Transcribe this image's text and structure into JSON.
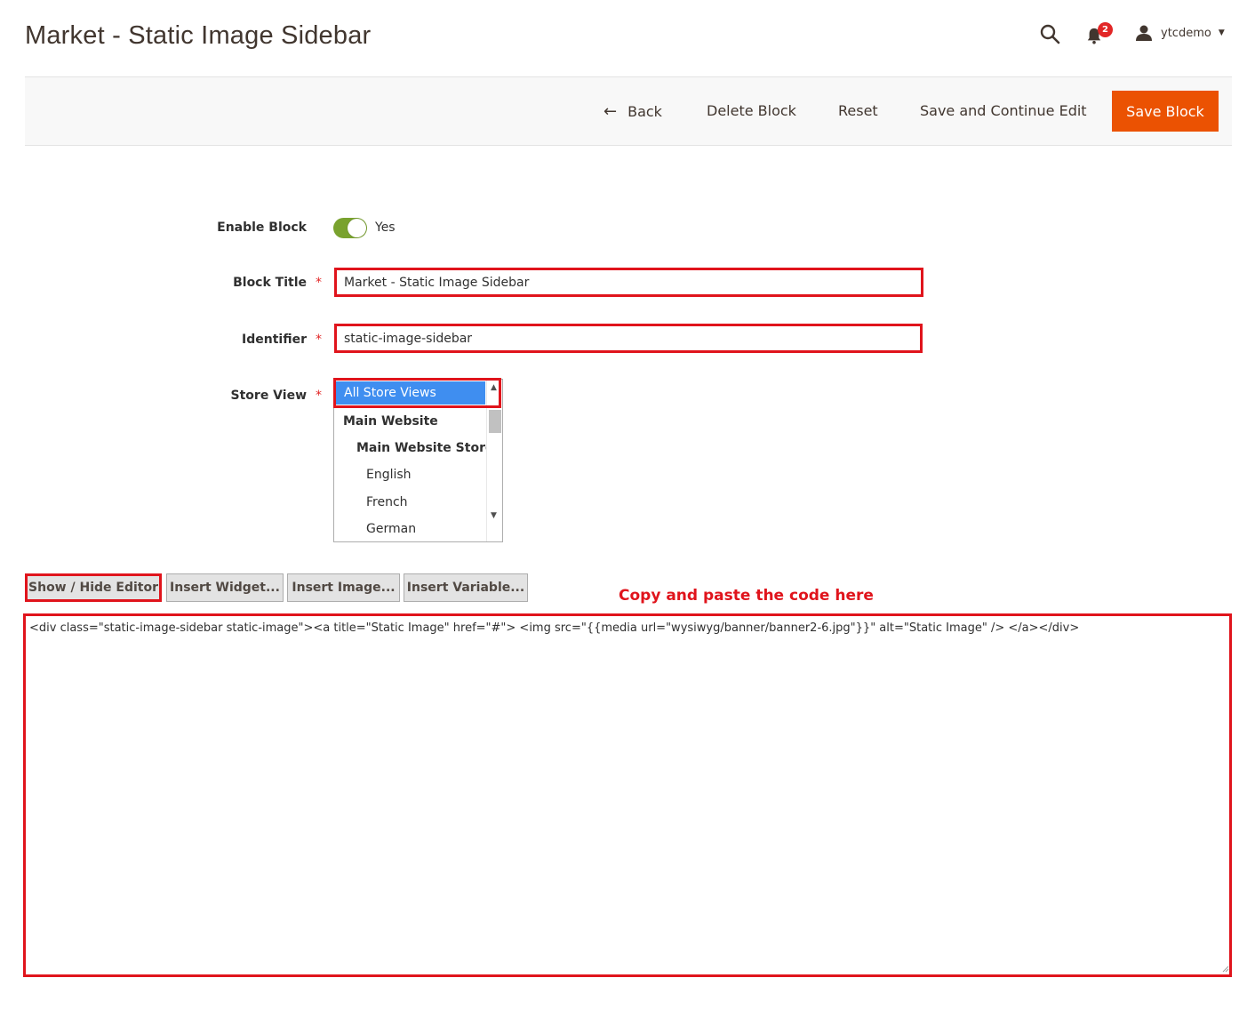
{
  "page": {
    "title": "Market - Static Image Sidebar"
  },
  "header": {
    "notifications_count": "2",
    "user_name": "ytcdemo"
  },
  "actions": {
    "back": "Back",
    "delete": "Delete Block",
    "reset": "Reset",
    "save_continue": "Save and Continue Edit",
    "save": "Save Block"
  },
  "form": {
    "enable_block": {
      "label": "Enable Block",
      "value": "Yes"
    },
    "block_title": {
      "label": "Block Title",
      "value": "Market - Static Image Sidebar"
    },
    "identifier": {
      "label": "Identifier",
      "value": "static-image-sidebar"
    },
    "store_view": {
      "label": "Store View",
      "options": [
        {
          "label": "All Store Views",
          "selected": true
        },
        {
          "label": "Main Website"
        },
        {
          "label": "Main Website Store"
        },
        {
          "label": "English"
        },
        {
          "label": "French"
        },
        {
          "label": "German"
        }
      ]
    },
    "required_mark": "*"
  },
  "editor": {
    "show_hide": "Show / Hide Editor",
    "insert_widget": "Insert Widget...",
    "insert_image": "Insert Image...",
    "insert_variable": "Insert Variable...",
    "annotation": "Copy and paste the code here",
    "content": "<div class=\"static-image-sidebar static-image\"><a title=\"Static Image\" href=\"#\"> <img src=\"{{media url=\"wysiwyg/banner/banner2-6.jpg\"}}\" alt=\"Static Image\" /> </a></div>"
  },
  "colors": {
    "primary_button": "#eb5202",
    "highlight": "#e0141c",
    "toggle_on": "#79a22e",
    "selected_option": "#3f8ef0"
  }
}
